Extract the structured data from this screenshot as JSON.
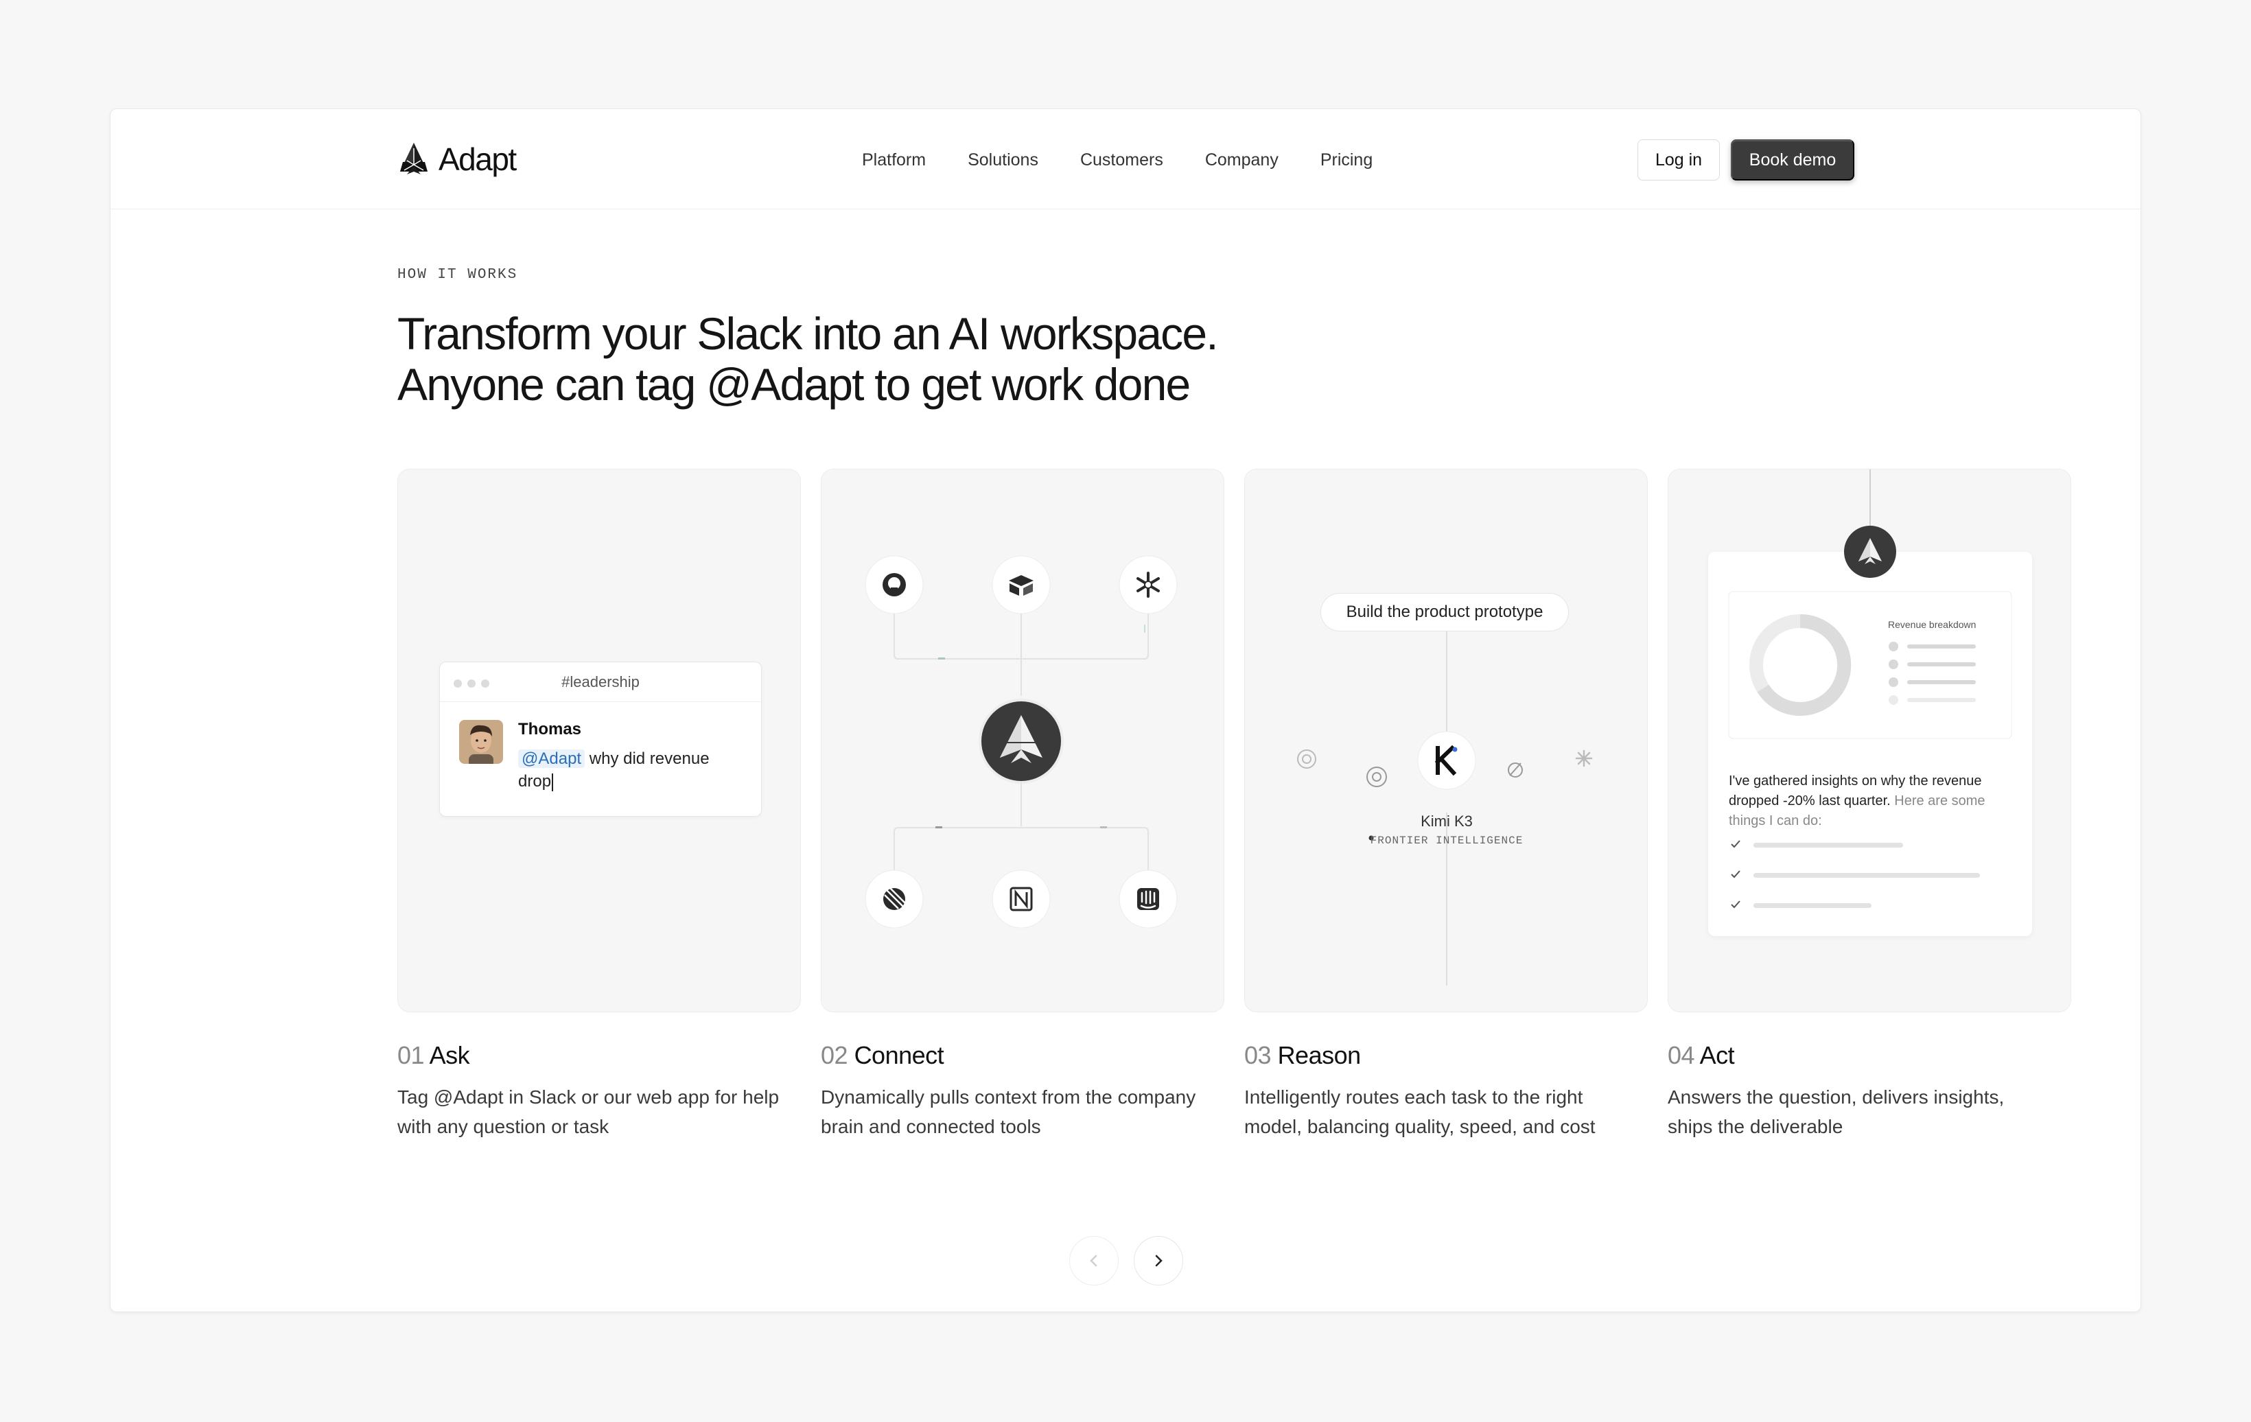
{
  "nav": {
    "brand": "Adapt",
    "links": [
      "Platform",
      "Solutions",
      "Customers",
      "Company",
      "Pricing"
    ],
    "login_label": "Log in",
    "demo_label": "Book demo"
  },
  "hero": {
    "eyebrow": "HOW IT WORKS",
    "headline_line1": "Transform your Slack into an AI workspace.",
    "headline_line2": "Anyone can tag @Adapt to get work done"
  },
  "card_ask": {
    "channel": "#leadership",
    "sender": "Thomas",
    "mention": "@Adapt",
    "message": "why did revenue drop"
  },
  "card_reason": {
    "prompt": "Build the product prototype",
    "model_name": "Kimi K3",
    "model_tag": "FRONTIER INTELLIGENCE"
  },
  "card_act": {
    "chart_label": "Revenue breakdown",
    "insight_main": "I've gathered insights on why the revenue dropped -20% last quarter.",
    "insight_muted": "Here are some things I can do:"
  },
  "steps": [
    {
      "num": "01",
      "title": "Ask",
      "desc": "Tag @Adapt in Slack or our web app for help with any question or task"
    },
    {
      "num": "02",
      "title": "Connect",
      "desc": "Dynamically pulls context from the company brain and connected tools"
    },
    {
      "num": "03",
      "title": "Reason",
      "desc": "Intelligently routes each task to the right model, balancing quality, speed, and cost"
    },
    {
      "num": "04",
      "title": "Act",
      "desc": "Answers the question, delivers insights, ships the deliverable"
    }
  ],
  "icons": {
    "brand": "adapt-logo-icon",
    "connect_top": [
      "github-icon",
      "airtable-icon",
      "snowflake-icon"
    ],
    "connect_bottom": [
      "linear-icon",
      "notion-icon",
      "intercom-icon"
    ],
    "reason_models": [
      "openai-icon",
      "openai-icon",
      "kimi-icon",
      "perplexity-icon",
      "claude-icon"
    ],
    "pager": [
      "chevron-left-icon",
      "chevron-right-icon"
    ]
  },
  "colors": {
    "accent_dark": "#3b3b3b",
    "mention_bg": "#e9f1fb",
    "mention_text": "#2a6fb8"
  }
}
